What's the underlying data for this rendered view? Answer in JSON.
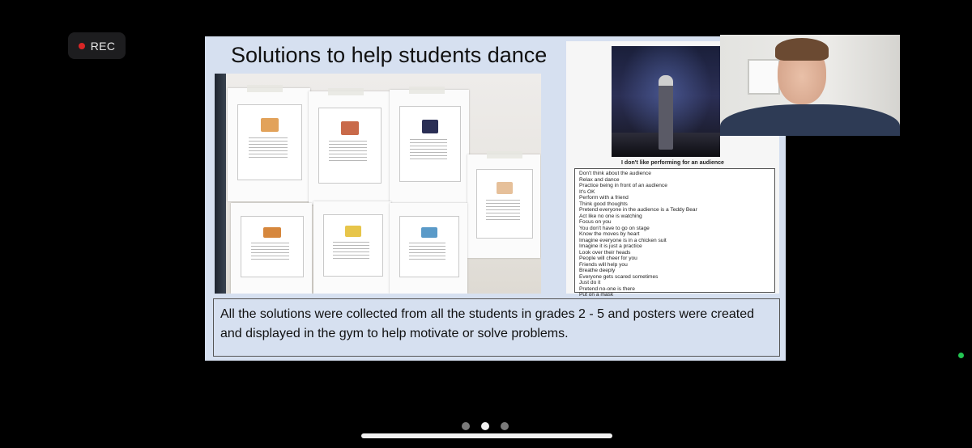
{
  "recording": {
    "label": "REC",
    "indicator_color": "#d92626"
  },
  "slide": {
    "title": "Solutions to help students dance",
    "poster_caption": "I don't like performing for an audience",
    "solutions": [
      "Don't think about the audience",
      "Relax and dance",
      "Practice being in front of an audience",
      "It's OK",
      "Perform with a friend",
      "Think good thoughts",
      "Pretend everyone in the audience is a Teddy Bear",
      "Act like no one is watching",
      "Focus on you",
      "You don't have to go on stage",
      "Know the moves by heart",
      "Imagine everyone is in a chicken suit",
      "Imagine it is just a practice",
      "Look over their heads",
      "People will cheer for you",
      "Friends will help you",
      "Breathe deeply",
      "Everyone gets scared sometimes",
      "Just do it",
      "Pretend no-one is there",
      "Put on a mask"
    ],
    "description": "All the solutions were collected from all the students in grades 2 - 5 and posters were created and displayed in the gym to help motivate or solve problems.",
    "background_color": "#d6e0f0"
  },
  "pager": {
    "page_count": 3,
    "active_index": 1
  },
  "status": {
    "active_indicator_color": "#23c552"
  },
  "icons": {
    "record": "record-dot-icon",
    "pager_dot": "page-dot-icon",
    "home": "home-indicator-icon"
  }
}
